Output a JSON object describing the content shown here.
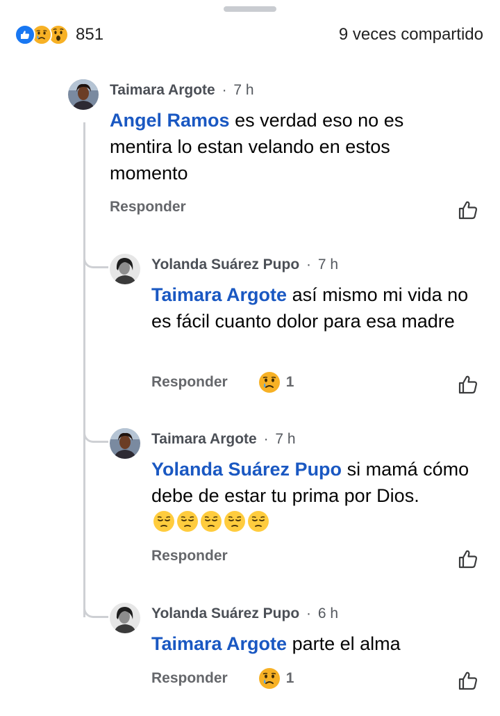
{
  "summary": {
    "reactions": [
      "like-icon",
      "sad-icon",
      "wow-icon"
    ],
    "reaction_count": "851",
    "shares_label": "9 veces compartido"
  },
  "comments": [
    {
      "author": "Taimara Argote",
      "time": "7 h",
      "mention": "Angel Ramos",
      "text": "es verdad eso no es mentira lo estan velando en estos momento",
      "reply_label": "Responder",
      "reaction_count": ""
    },
    {
      "author": "Yolanda Suárez Pupo",
      "time": "7 h",
      "mention": "Taimara Argote",
      "text": "así mismo mi vida no es fácil cuanto dolor para esa madre",
      "reply_label": "Responder",
      "reaction_count": "1"
    },
    {
      "author": "Taimara Argote",
      "time": "7 h",
      "mention": "Yolanda Suárez Pupo",
      "text": "si mamá cómo debe de estar tu prima por Dios.",
      "reply_label": "Responder",
      "reaction_count": ""
    },
    {
      "author": "Yolanda Suárez Pupo",
      "time": "6 h",
      "mention": "Taimara Argote",
      "text": "parte el alma",
      "reply_label": "Responder",
      "reaction_count": "1"
    }
  ],
  "colors": {
    "mention": "#1a58c2",
    "like_blue": "#1877f2",
    "emoji_yellow": "#f7b125",
    "muted_text": "#65676b"
  }
}
